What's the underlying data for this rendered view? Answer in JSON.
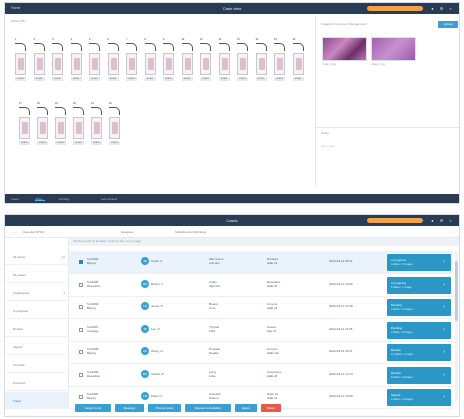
{
  "top_window": {
    "title_left": "Home",
    "title": "Case view",
    "slides_label": "Slides (16)",
    "images_label": "Images & Document Management",
    "add_button": "Upload",
    "notes_label": "Notes",
    "notes_placeholder": "Add a note...",
    "thumbnails": [
      {
        "caption": "Image_1.jpg"
      },
      {
        "caption": "Image_2.jpg"
      }
    ],
    "slides_row1": [
      "1",
      "2",
      "3",
      "4",
      "5",
      "6",
      "7",
      "8",
      "9",
      "10",
      "11",
      "12",
      "13",
      "14",
      "15",
      "16"
    ],
    "slides_row2": [
      "17",
      "18",
      "19",
      "20",
      "21",
      "22"
    ],
    "slide_tag": "S-0001",
    "status": {
      "left": "Cases",
      "tab1": "Slides",
      "tab2": "Pending",
      "right": "Last updated"
    }
  },
  "bottom_window": {
    "title": "Cases",
    "toolbar": {
      "back": "←",
      "case_id": "Case list (3710)",
      "col_a": "Assignee",
      "col_b": "Submitted to Pathology"
    },
    "filter_text": "Showing results for all cases • sorted by date • 10 per page",
    "sidebar": [
      {
        "label": "All cases",
        "count": "10"
      },
      {
        "label": "My cases",
        "count": ""
      },
      {
        "label": "Unassigned",
        "count": "3"
      },
      {
        "label": "In progress",
        "count": ""
      },
      {
        "label": "Review",
        "count": ""
      },
      {
        "label": "Signed",
        "count": ""
      },
      {
        "label": "Consults",
        "count": ""
      },
      {
        "label": "Archived",
        "count": ""
      },
      {
        "label": "Trash",
        "count": ""
      }
    ],
    "rows": [
      {
        "id": "S-10294",
        "sub": "Biopsy",
        "initials": "JD",
        "name": "Smith, A.",
        "spec": "Skin lesion",
        "spec2": "Left arm",
        "tissue": "Excision",
        "tissue2": "H&E x4",
        "date": "2024-03-12 09:41",
        "status": "In progress",
        "status_sub": "4 slides • 2 images"
      },
      {
        "id": "S-10295",
        "sub": "Resection",
        "initials": "MK",
        "name": "Brown, T.",
        "spec": "Colon",
        "spec2": "Sigmoid",
        "tissue": "Resection",
        "tissue2": "H&E x6",
        "date": "2024-03-12 10:02",
        "status": "In progress",
        "status_sub": "6 slides • 1 image"
      },
      {
        "id": "S-10296",
        "sub": "Biopsy",
        "initials": "LR",
        "name": "Jones, P.",
        "spec": "Breast",
        "spec2": "Core",
        "tissue": "Core bx",
        "tissue2": "H&E x3",
        "date": "2024-03-12 10:18",
        "status": "Pending",
        "status_sub": "3 slides • 0 images"
      },
      {
        "id": "S-10297",
        "sub": "Cytology",
        "initials": "JD",
        "name": "Lee, S.",
        "spec": "Thyroid",
        "spec2": "FNA",
        "tissue": "Smear",
        "tissue2": "Pap x2",
        "date": "2024-03-12 11:05",
        "status": "Pending",
        "status_sub": "2 slides • 0 images"
      },
      {
        "id": "S-10298",
        "sub": "Biopsy",
        "initials": "AK",
        "name": "Wong, H.",
        "spec": "Prostate",
        "spec2": "Needle",
        "tissue": "Core bx",
        "tissue2": "H&E x12",
        "date": "2024-03-12 11:37",
        "status": "Review",
        "status_sub": "12 slides • 1 image"
      },
      {
        "id": "S-10299",
        "sub": "Resection",
        "initials": "MK",
        "name": "Garcia, R.",
        "spec": "Lung",
        "spec2": "Lobe",
        "tissue": "Lobectomy",
        "tissue2": "H&E x8",
        "date": "2024-03-12 12:14",
        "status": "Review",
        "status_sub": "8 slides • 3 images"
      },
      {
        "id": "S-10300",
        "sub": "Biopsy",
        "initials": "LR",
        "name": "Patel, N.",
        "spec": "Stomach",
        "spec2": "Antrum",
        "tissue": "Endo bx",
        "tissue2": "H&E x2",
        "date": "2024-03-12 12:50",
        "status": "Signed",
        "status_sub": "2 slides • 0 images"
      }
    ],
    "actions": [
      "Assign to me",
      "Reassign",
      "Change status",
      "Request consultation",
      "Export",
      "Delete"
    ]
  },
  "colors": {
    "titlebar": "#2a3c54",
    "accent": "#3aa0d2",
    "search": "#f0a150",
    "danger": "#e55a4e"
  }
}
